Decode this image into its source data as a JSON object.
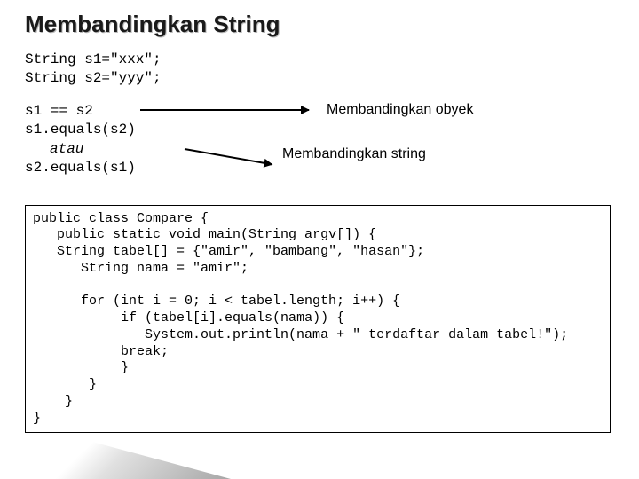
{
  "title": "Membandingkan String",
  "decl": {
    "l1": "String s1=\"xxx\";",
    "l2": "String s2=\"yyy\";"
  },
  "cmp": {
    "eq": "s1 == s2",
    "m1": "s1.equals(s2)",
    "atau": "atau",
    "m2": "s2.equals(s1)"
  },
  "labels": {
    "obyek": "Membandingkan obyek",
    "string": "Membandingkan string"
  },
  "code": "public class Compare {\n   public static void main(String argv[]) {\n   String tabel[] = {\"amir\", \"bambang\", \"hasan\"};\n      String nama = \"amir\";\n\n      for (int i = 0; i < tabel.length; i++) {\n           if (tabel[i].equals(nama)) {\n              System.out.println(nama + \" terdaftar dalam tabel!\");\n           break;\n           }\n       }\n    }\n}"
}
